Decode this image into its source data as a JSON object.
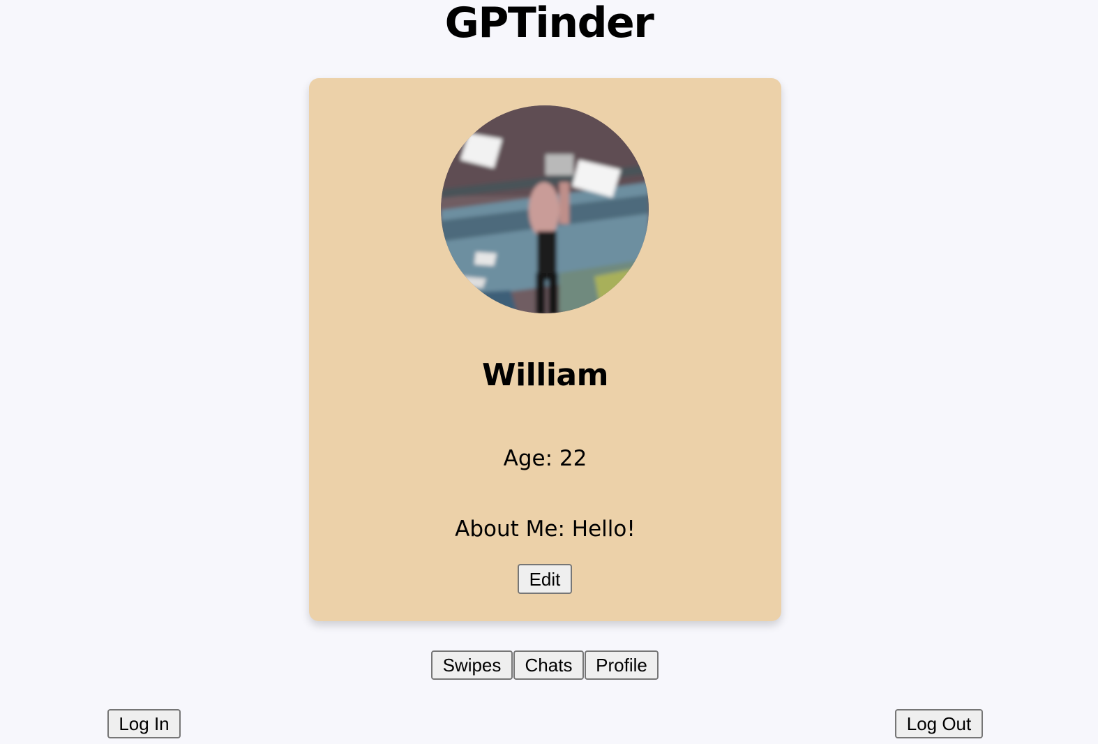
{
  "app": {
    "title": "GPTinder"
  },
  "profile": {
    "avatar": "profile-photo",
    "name": "William",
    "age_text": "Age: 22",
    "about_text": "About Me: Hello!",
    "edit_label": "Edit",
    "card_color": "#ecd1a9"
  },
  "nav": {
    "items": [
      {
        "label": "Swipes"
      },
      {
        "label": "Chats"
      },
      {
        "label": "Profile"
      }
    ]
  },
  "auth": {
    "login_label": "Log In",
    "logout_label": "Log Out"
  },
  "colors": {
    "background": "#f7f7fc",
    "button_bg": "#efefef",
    "button_border": "#767676"
  }
}
